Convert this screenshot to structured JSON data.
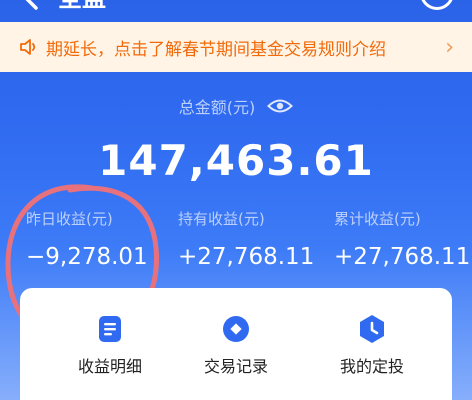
{
  "nav": {
    "title": "全盈",
    "back_icon": "chevron-left-icon",
    "right_icon": "help-icon"
  },
  "notice": {
    "icon": "speaker-icon",
    "text": "期延长，点击了解春节期间基金交易规则介绍",
    "arrow": "›"
  },
  "summary": {
    "total_label": "总金额(元)",
    "visibility_icon": "eye-icon",
    "total_amount": "147,463.61",
    "stats": [
      {
        "label": "昨日收益(元)",
        "value": "−9,278.01"
      },
      {
        "label": "持有收益(元)",
        "value": "+27,768.11"
      },
      {
        "label": "累计收益(元)",
        "value": "+27,768.11"
      }
    ]
  },
  "actions": [
    {
      "label": "收益明细",
      "icon": "document-icon"
    },
    {
      "label": "交易记录",
      "icon": "record-icon"
    },
    {
      "label": "我的定投",
      "icon": "clock-icon"
    }
  ],
  "colors": {
    "accent": "#2f6af0",
    "notice_bg": "#fff4e6",
    "notice_text": "#f26a0a",
    "annotation": "#e8717e"
  }
}
